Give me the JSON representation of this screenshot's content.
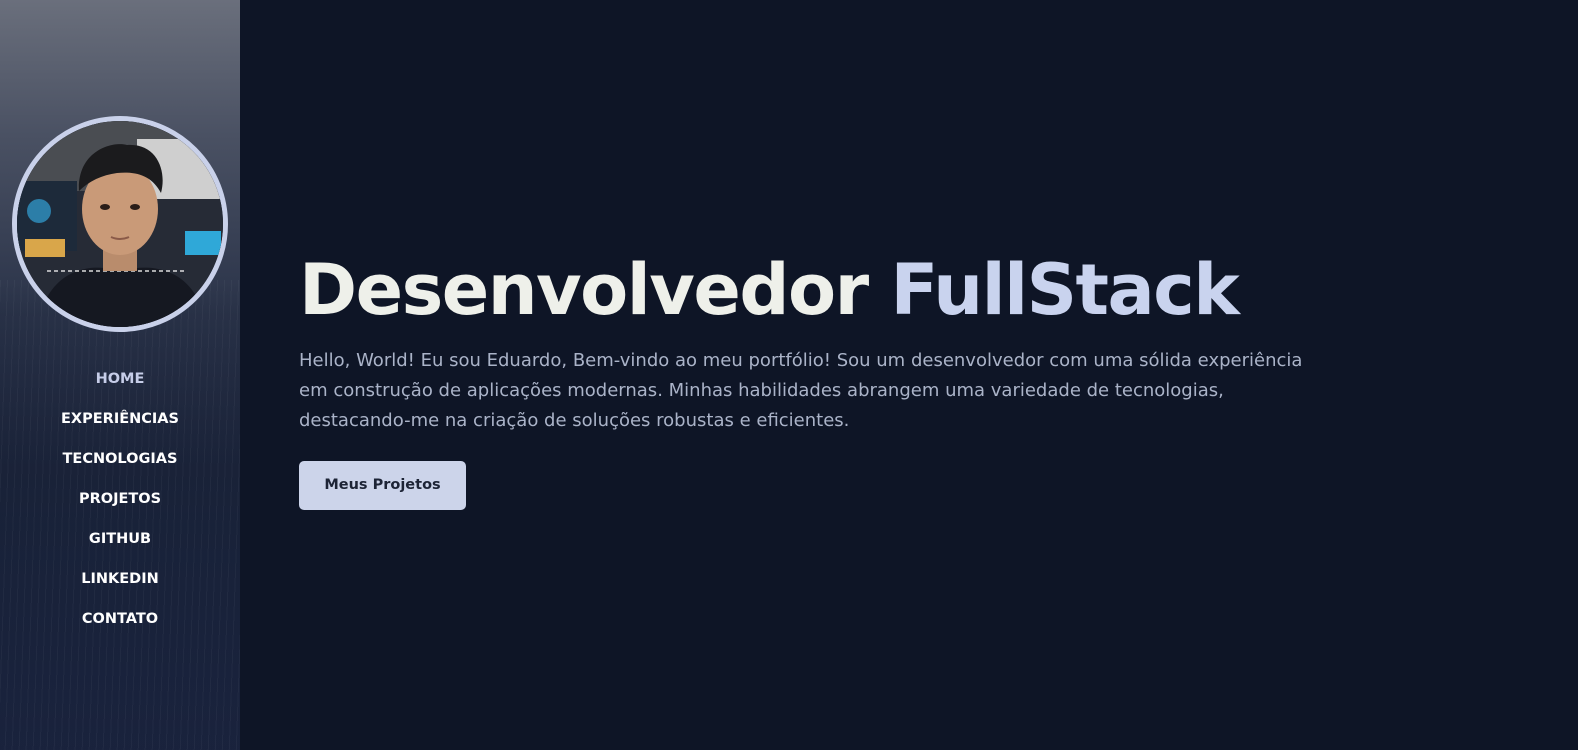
{
  "sidebar": {
    "nav": [
      {
        "label": "HOME",
        "active": true
      },
      {
        "label": "EXPERIÊNCIAS"
      },
      {
        "label": "TECNOLOGIAS"
      },
      {
        "label": "PROJETOS"
      },
      {
        "label": "GITHUB"
      },
      {
        "label": "LINKEDIN"
      },
      {
        "label": "CONTATO"
      }
    ]
  },
  "hero": {
    "title_main": "Desenvolvedor ",
    "title_accent": "FullStack",
    "intro": "Hello, World! Eu sou Eduardo, Bem-vindo ao meu portfólio! Sou um desenvolvedor com uma sólida experiência em construção de aplicações modernas. Minhas habilidades abrangem uma variedade de tecnologias, destacando-me na criação de soluções robustas e eficientes.",
    "cta_label": "Meus Projetos"
  },
  "colors": {
    "background": "#0e1526",
    "accent": "#c9d3ee",
    "headline": "#eef0ea",
    "button": "#ccd4ea"
  }
}
